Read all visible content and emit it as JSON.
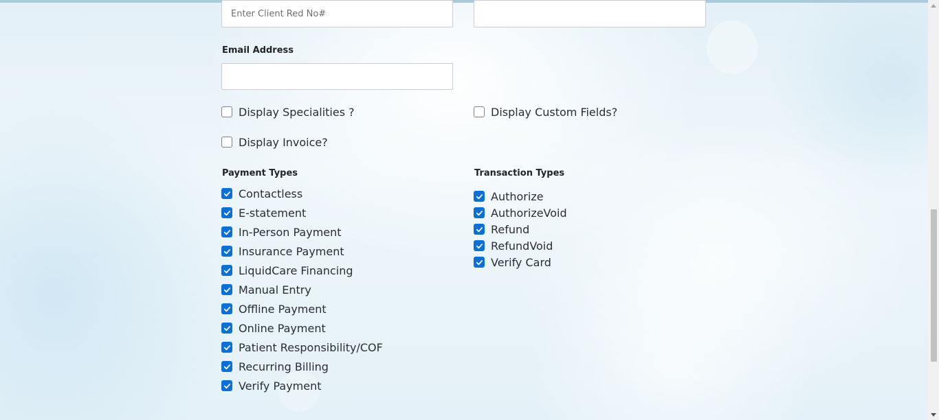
{
  "client_ref": {
    "placeholder": "Enter Client Red No#",
    "value": ""
  },
  "right_field": {
    "value": ""
  },
  "email": {
    "label": "Email Address",
    "value": ""
  },
  "options": {
    "display_specialities": {
      "label": "Display Specialities ?",
      "checked": false
    },
    "display_custom_fields": {
      "label": "Display Custom Fields?",
      "checked": false
    },
    "display_invoice": {
      "label": "Display Invoice?",
      "checked": false
    }
  },
  "payment_types": {
    "heading": "Payment Types",
    "items": [
      {
        "label": "Contactless",
        "checked": true
      },
      {
        "label": "E-statement",
        "checked": true
      },
      {
        "label": "In-Person Payment",
        "checked": true
      },
      {
        "label": "Insurance Payment",
        "checked": true
      },
      {
        "label": "LiquidCare Financing",
        "checked": true
      },
      {
        "label": "Manual Entry",
        "checked": true
      },
      {
        "label": "Offline Payment",
        "checked": true
      },
      {
        "label": "Online Payment",
        "checked": true
      },
      {
        "label": "Patient Responsibility/COF",
        "checked": true
      },
      {
        "label": "Recurring Billing",
        "checked": true
      },
      {
        "label": "Verify Payment",
        "checked": true
      }
    ]
  },
  "transaction_types": {
    "heading": "Transaction Types",
    "items": [
      {
        "label": "Authorize",
        "checked": true
      },
      {
        "label": "AuthorizeVoid",
        "checked": true
      },
      {
        "label": "Refund",
        "checked": true
      },
      {
        "label": "RefundVoid",
        "checked": true
      },
      {
        "label": "Verify Card",
        "checked": true
      }
    ]
  },
  "colors": {
    "accent": "#0a6fd8",
    "text": "#2a2e33",
    "input_border": "#c9ced4"
  }
}
